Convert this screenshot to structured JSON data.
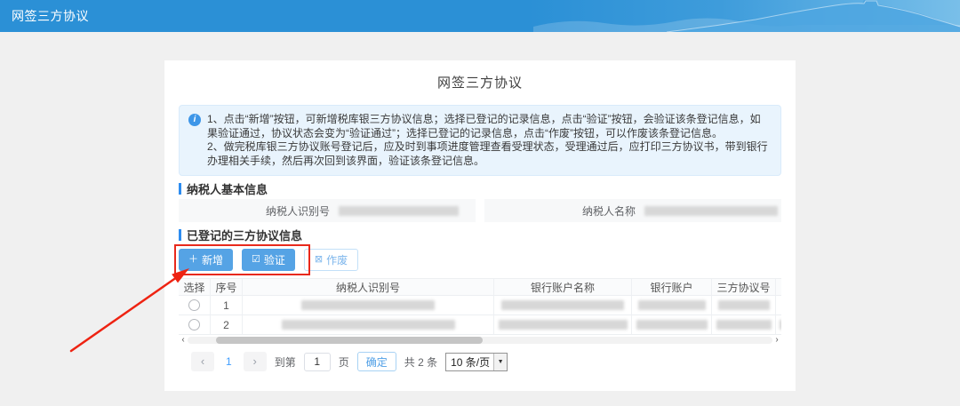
{
  "colors": {
    "header_blue": "#2b90d6",
    "primary_button_blue": "#55a3e5",
    "section_bar_blue": "#2d8cf0",
    "notice_bg": "#e9f4fd",
    "link_blue": "#409eff",
    "annotation_red": "#e8291c"
  },
  "header": {
    "title": "网签三方协议"
  },
  "card": {
    "title": "网签三方协议",
    "notice": {
      "line1": "1、点击“新增”按钮，可新增税库银三方协议信息；选择已登记的记录信息，点击“验证”按钮，会验证该条登记信息，如果验证通过，协议状态会变为“验证通过”；选择已登记的记录信息，点击“作废”按钮，可以作废该条登记信息。",
      "line2": "2、做完税库银三方协议账号登记后，应及时到事项进度管理查看受理状态，受理通过后，应打印三方协议书，带到银行办理相关手续，然后再次回到该界面，验证该条登记信息。"
    },
    "taxpayer_section": {
      "title": "纳税人基本信息",
      "fields": [
        {
          "label": "纳税人识别号"
        },
        {
          "label": "纳税人名称"
        }
      ]
    },
    "agreements_section": {
      "title": "已登记的三方协议信息",
      "buttons": {
        "add": "新增",
        "verify": "验证",
        "void": "作废"
      },
      "table": {
        "columns": [
          "选择",
          "序号",
          "纳税人识别号",
          "银行账户名称",
          "银行账户",
          "三方协议号"
        ],
        "rows": [
          {
            "no": "1"
          },
          {
            "no": "2"
          }
        ]
      },
      "pagination": {
        "current_page": "1",
        "goto_prefix": "到第",
        "goto_value": "1",
        "goto_suffix": "页",
        "confirm": "确定",
        "total": "共 2 条",
        "page_size": "10 条/页"
      }
    }
  },
  "icons": {
    "info": "i",
    "plus": "＋",
    "check_square": "☑",
    "void_square": "⊠",
    "chevron_left": "‹",
    "chevron_right": "›",
    "dropdown_caret": "▼"
  }
}
